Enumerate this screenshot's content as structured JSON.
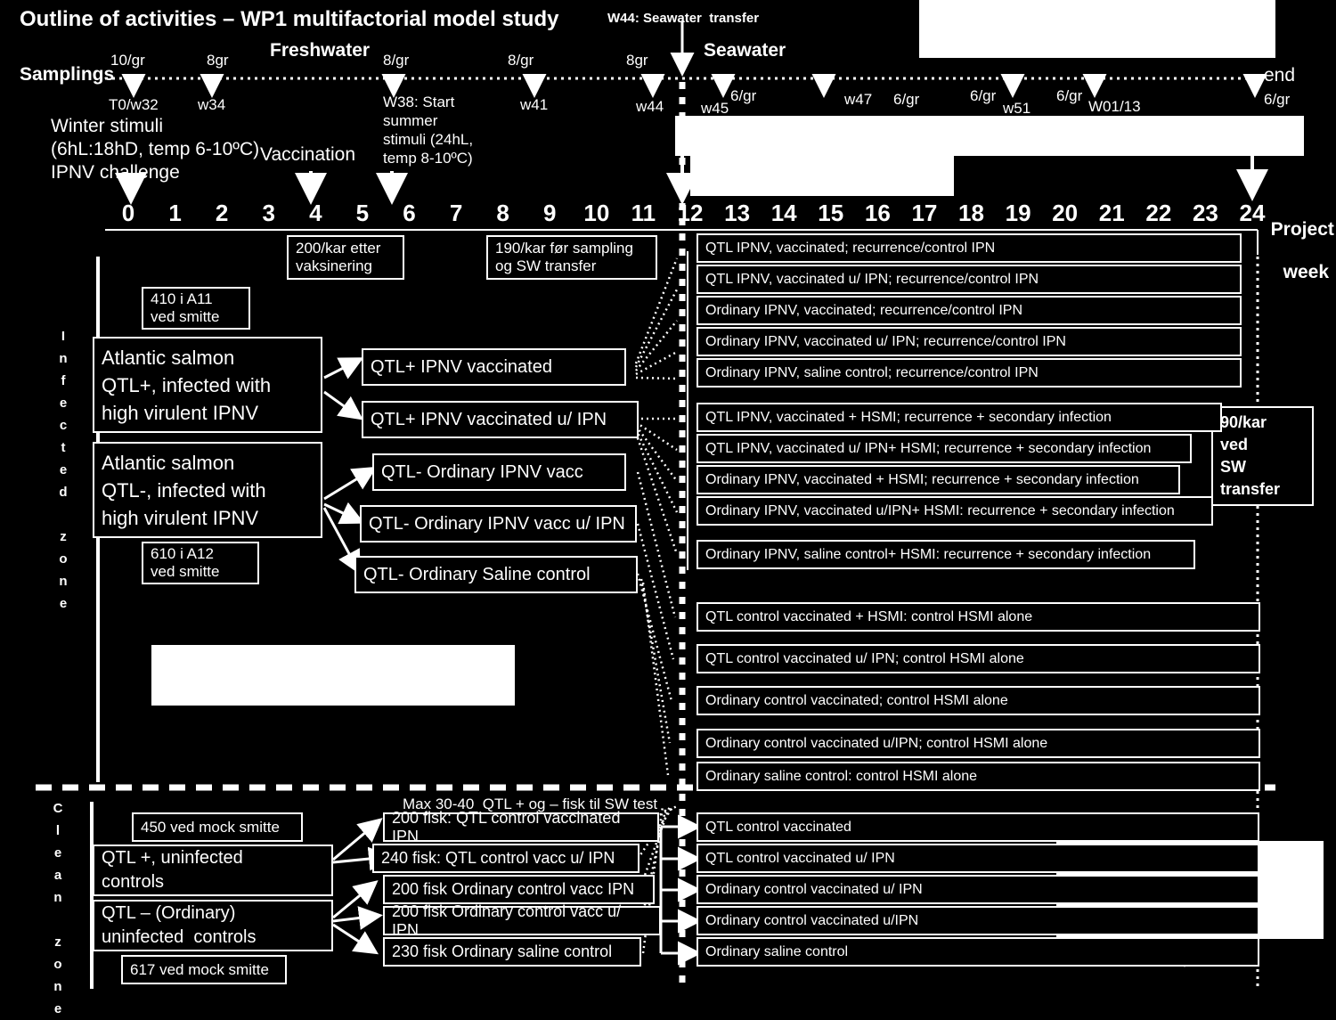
{
  "title": "Outline of activities – WP1 multifactorial model study",
  "timeline": {
    "samplings_label": "Samplings",
    "freshwater_label": "Freshwater",
    "seawater_label": "Seawater",
    "sw_transfer_note": "W44: Seawater  transfer",
    "end_label": "end",
    "end_gr": "6/gr",
    "project_week_label_line1": "Project",
    "project_week_label_line2": "week",
    "marks": [
      {
        "gr": "10/gr",
        "week": "T0/w32"
      },
      {
        "gr": "8gr",
        "week": "w34"
      },
      {
        "gr": "8/gr",
        "week": "W38: Start summer stimuli (24hL, temp 8-10ºC)"
      },
      {
        "gr": "8/gr",
        "week": "w41"
      },
      {
        "gr": "8gr",
        "week": "w44"
      },
      {
        "gr": "6/gr",
        "week": "w45"
      },
      {
        "gr": "6/gr",
        "week": "w47"
      },
      {
        "gr": "6/gr",
        "week": "w51"
      },
      {
        "gr": "6/gr",
        "week": "W01/13"
      }
    ],
    "week_numbers": [
      "0",
      "1",
      "2",
      "3",
      "4",
      "5",
      "6",
      "7",
      "8",
      "9",
      "10",
      "11",
      "12",
      "13",
      "14",
      "15",
      "16",
      "17",
      "18",
      "19",
      "20",
      "21",
      "22",
      "23",
      "24"
    ]
  },
  "annotations": {
    "winter_stimuli": "Winter stimuli\n(6hL:18hD, temp 6-10ºC)\nIPNV challenge",
    "vaccination": "Vaccination",
    "summer_stimuli": "W38: Start\nsummer\nstimuli (24hL,\ntemp 8-10ºC)",
    "w38_label": "W38: Start",
    "note_200_kar": "200/kar etter\nvaksinering",
    "note_190_kar": "190/kar før sampling\nog SW transfer",
    "note_90_kar": "90/kar\nved\nSW\ntransfer",
    "max_sw_test": "Max 30-40  QTL + og – fisk til SW test"
  },
  "zones": {
    "infected": "Infected zone",
    "clean": "Clean zone"
  },
  "infected": {
    "counts": [
      "410 i A11\nved smitte",
      "610 i A12\nved smitte"
    ],
    "sources": [
      "Atlantic salmon\nQTL+, infected with\nhigh virulent IPNV",
      "Atlantic salmon\nQTL-, infected with\nhigh virulent IPNV"
    ],
    "groups": [
      "QTL+   IPNV vaccinated",
      "QTL+ IPNV vaccinated u/ IPN",
      "QTL- Ordinary  IPNV vacc",
      "QTL- Ordinary IPNV vacc u/ IPN",
      "QTL- Ordinary   Saline control"
    ],
    "outcomes_group1": [
      "QTL IPNV, vaccinated; recurrence/control IPN",
      "QTL IPNV, vaccinated u/ IPN; recurrence/control IPN",
      "Ordinary IPNV, vaccinated; recurrence/control IPN",
      "Ordinary IPNV, vaccinated u/ IPN; recurrence/control IPN",
      "Ordinary IPNV, saline control; recurrence/control IPN"
    ],
    "outcomes_group2": [
      "QTL IPNV, vaccinated + HSMI; recurrence + secondary infection",
      "QTL IPNV, vaccinated u/ IPN+ HSMI; recurrence + secondary infection",
      "Ordinary  IPNV, vaccinated + HSMI; recurrence + secondary infection",
      "Ordinary IPNV, vaccinated u/IPN+ HSMI: recurrence + secondary infection",
      "Ordinary IPNV, saline control+ HSMI: recurrence + secondary infection"
    ],
    "outcomes_group3": [
      "QTL control vaccinated + HSMI: control HSMI alone",
      "QTL control vaccinated u/ IPN; control HSMI alone",
      "Ordinary control vaccinated; control HSMI alone",
      "Ordinary control vaccinated u/IPN; control HSMI alone",
      "Ordinary saline control:  control HSMI alone"
    ]
  },
  "clean": {
    "counts": [
      "450 ved mock smitte",
      "617 ved mock smitte"
    ],
    "sources": [
      "QTL +, uninfected\ncontrols",
      "QTL – (Ordinary)\nuninfected  controls"
    ],
    "groups": [
      "200 fisk: QTL control vaccinated IPN",
      "240 fisk: QTL control vacc u/ IPN",
      "200 fisk Ordinary control vacc IPN",
      "200 fisk Ordinary control vacc u/ IPN",
      "230 fisk Ordinary saline control"
    ],
    "outcomes": [
      "QTL control vaccinated",
      "QTL control vaccinated u/ IPN",
      "Ordinary control vaccinated u/ IPN",
      "Ordinary control vaccinated u/IPN",
      "Ordinary saline control"
    ]
  },
  "colors": {
    "background": "#000000",
    "foreground": "#ffffff"
  }
}
